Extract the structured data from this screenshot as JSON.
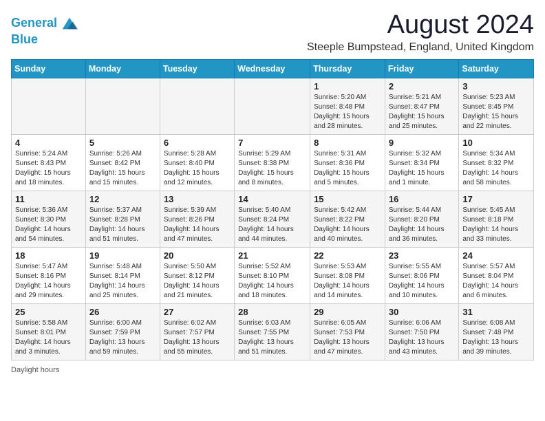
{
  "header": {
    "logo_line1": "General",
    "logo_line2": "Blue",
    "title": "August 2024",
    "subtitle": "Steeple Bumpstead, England, United Kingdom"
  },
  "calendar": {
    "days_of_week": [
      "Sunday",
      "Monday",
      "Tuesday",
      "Wednesday",
      "Thursday",
      "Friday",
      "Saturday"
    ],
    "weeks": [
      [
        {
          "day": "",
          "info": ""
        },
        {
          "day": "",
          "info": ""
        },
        {
          "day": "",
          "info": ""
        },
        {
          "day": "",
          "info": ""
        },
        {
          "day": "1",
          "info": "Sunrise: 5:20 AM\nSunset: 8:48 PM\nDaylight: 15 hours\nand 28 minutes."
        },
        {
          "day": "2",
          "info": "Sunrise: 5:21 AM\nSunset: 8:47 PM\nDaylight: 15 hours\nand 25 minutes."
        },
        {
          "day": "3",
          "info": "Sunrise: 5:23 AM\nSunset: 8:45 PM\nDaylight: 15 hours\nand 22 minutes."
        }
      ],
      [
        {
          "day": "4",
          "info": "Sunrise: 5:24 AM\nSunset: 8:43 PM\nDaylight: 15 hours\nand 18 minutes."
        },
        {
          "day": "5",
          "info": "Sunrise: 5:26 AM\nSunset: 8:42 PM\nDaylight: 15 hours\nand 15 minutes."
        },
        {
          "day": "6",
          "info": "Sunrise: 5:28 AM\nSunset: 8:40 PM\nDaylight: 15 hours\nand 12 minutes."
        },
        {
          "day": "7",
          "info": "Sunrise: 5:29 AM\nSunset: 8:38 PM\nDaylight: 15 hours\nand 8 minutes."
        },
        {
          "day": "8",
          "info": "Sunrise: 5:31 AM\nSunset: 8:36 PM\nDaylight: 15 hours\nand 5 minutes."
        },
        {
          "day": "9",
          "info": "Sunrise: 5:32 AM\nSunset: 8:34 PM\nDaylight: 15 hours\nand 1 minute."
        },
        {
          "day": "10",
          "info": "Sunrise: 5:34 AM\nSunset: 8:32 PM\nDaylight: 14 hours\nand 58 minutes."
        }
      ],
      [
        {
          "day": "11",
          "info": "Sunrise: 5:36 AM\nSunset: 8:30 PM\nDaylight: 14 hours\nand 54 minutes."
        },
        {
          "day": "12",
          "info": "Sunrise: 5:37 AM\nSunset: 8:28 PM\nDaylight: 14 hours\nand 51 minutes."
        },
        {
          "day": "13",
          "info": "Sunrise: 5:39 AM\nSunset: 8:26 PM\nDaylight: 14 hours\nand 47 minutes."
        },
        {
          "day": "14",
          "info": "Sunrise: 5:40 AM\nSunset: 8:24 PM\nDaylight: 14 hours\nand 44 minutes."
        },
        {
          "day": "15",
          "info": "Sunrise: 5:42 AM\nSunset: 8:22 PM\nDaylight: 14 hours\nand 40 minutes."
        },
        {
          "day": "16",
          "info": "Sunrise: 5:44 AM\nSunset: 8:20 PM\nDaylight: 14 hours\nand 36 minutes."
        },
        {
          "day": "17",
          "info": "Sunrise: 5:45 AM\nSunset: 8:18 PM\nDaylight: 14 hours\nand 33 minutes."
        }
      ],
      [
        {
          "day": "18",
          "info": "Sunrise: 5:47 AM\nSunset: 8:16 PM\nDaylight: 14 hours\nand 29 minutes."
        },
        {
          "day": "19",
          "info": "Sunrise: 5:48 AM\nSunset: 8:14 PM\nDaylight: 14 hours\nand 25 minutes."
        },
        {
          "day": "20",
          "info": "Sunrise: 5:50 AM\nSunset: 8:12 PM\nDaylight: 14 hours\nand 21 minutes."
        },
        {
          "day": "21",
          "info": "Sunrise: 5:52 AM\nSunset: 8:10 PM\nDaylight: 14 hours\nand 18 minutes."
        },
        {
          "day": "22",
          "info": "Sunrise: 5:53 AM\nSunset: 8:08 PM\nDaylight: 14 hours\nand 14 minutes."
        },
        {
          "day": "23",
          "info": "Sunrise: 5:55 AM\nSunset: 8:06 PM\nDaylight: 14 hours\nand 10 minutes."
        },
        {
          "day": "24",
          "info": "Sunrise: 5:57 AM\nSunset: 8:04 PM\nDaylight: 14 hours\nand 6 minutes."
        }
      ],
      [
        {
          "day": "25",
          "info": "Sunrise: 5:58 AM\nSunset: 8:01 PM\nDaylight: 14 hours\nand 3 minutes."
        },
        {
          "day": "26",
          "info": "Sunrise: 6:00 AM\nSunset: 7:59 PM\nDaylight: 13 hours\nand 59 minutes."
        },
        {
          "day": "27",
          "info": "Sunrise: 6:02 AM\nSunset: 7:57 PM\nDaylight: 13 hours\nand 55 minutes."
        },
        {
          "day": "28",
          "info": "Sunrise: 6:03 AM\nSunset: 7:55 PM\nDaylight: 13 hours\nand 51 minutes."
        },
        {
          "day": "29",
          "info": "Sunrise: 6:05 AM\nSunset: 7:53 PM\nDaylight: 13 hours\nand 47 minutes."
        },
        {
          "day": "30",
          "info": "Sunrise: 6:06 AM\nSunset: 7:50 PM\nDaylight: 13 hours\nand 43 minutes."
        },
        {
          "day": "31",
          "info": "Sunrise: 6:08 AM\nSunset: 7:48 PM\nDaylight: 13 hours\nand 39 minutes."
        }
      ]
    ]
  },
  "footer": {
    "note": "Daylight hours"
  }
}
